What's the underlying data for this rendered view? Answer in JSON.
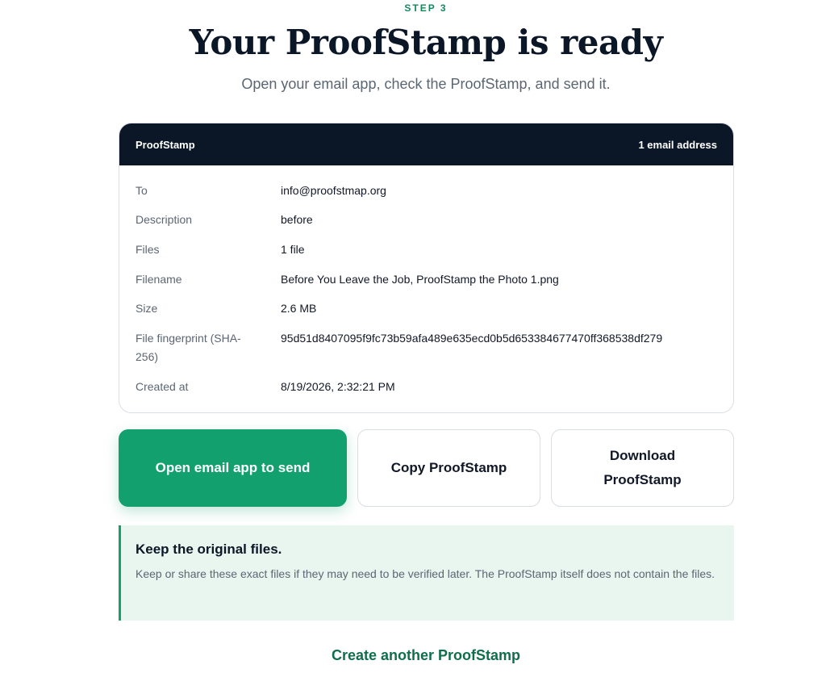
{
  "header": {
    "step": "STEP 3",
    "title": "Your ProofStamp is ready",
    "subtitle": "Open your email app, check the ProofStamp, and send it."
  },
  "card": {
    "title": "ProofStamp",
    "count": "1 email address",
    "rows": [
      {
        "label": "To",
        "value": "info@proofstmap.org"
      },
      {
        "label": "Description",
        "value": "before"
      },
      {
        "label": "Files",
        "value": "1 file"
      },
      {
        "label": "Filename",
        "value": "Before You Leave the Job, ProofStamp the Photo 1.png"
      },
      {
        "label": "Size",
        "value": "2.6 MB"
      },
      {
        "label": "File fingerprint (SHA-256)",
        "value": "95d51d8407095f9fc73b59afa489e635ecd0b5d653384677470ff368538df279"
      },
      {
        "label": "Created at",
        "value": "8/19/2026, 2:32:21 PM"
      }
    ]
  },
  "actions": {
    "open_email": "Open email app to send",
    "copy": "Copy ProofStamp",
    "download": "Download ProofStamp"
  },
  "note": {
    "title": "Keep the original files.",
    "body": "Keep or share these exact files if they may need to be verified later. The ProofStamp itself does not contain the files."
  },
  "footer": {
    "create_another": "Create another ProofStamp"
  },
  "colors": {
    "accent": "#12a06f",
    "dark": "#0b1626",
    "note_bg": "#e9f6ef"
  }
}
